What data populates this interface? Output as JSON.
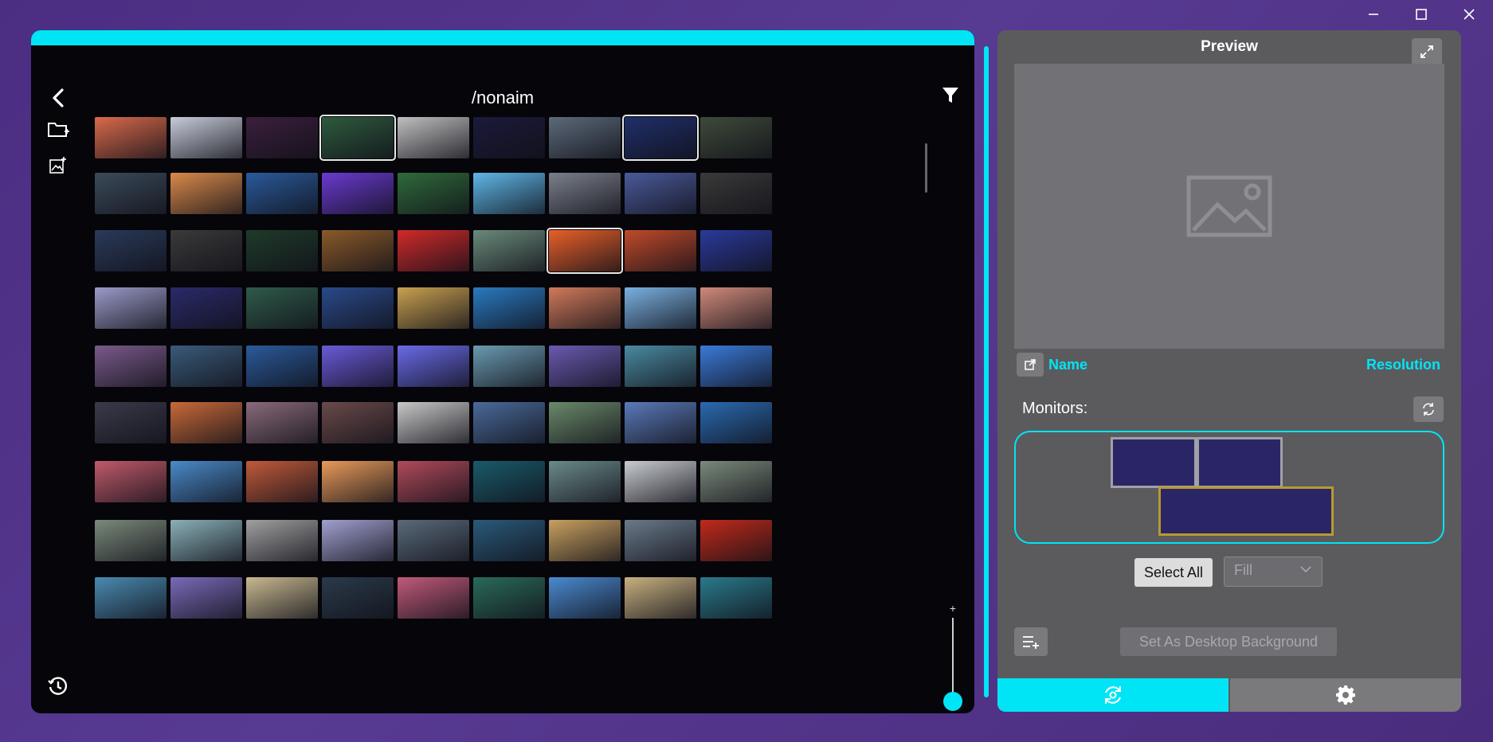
{
  "window_controls": {
    "minimize": "minimize-icon",
    "maximize": "maximize-icon",
    "close": "close-icon"
  },
  "browser": {
    "path": "/nonaim",
    "icons": {
      "back": "chevron-left-icon",
      "filter": "filter-icon",
      "new_folder": "folder-add-icon",
      "add_image": "image-add-icon",
      "history": "history-icon"
    },
    "zoom": {
      "plus": "+",
      "minus": "-",
      "level": 0.2
    },
    "thumbnails": [
      [
        "#d96a4c",
        "#c7ccd9",
        "#3a1f3c",
        "#2e5a3e",
        "#bfbfbf",
        "#1b1a3a",
        "#5c6a7a",
        "#1f2f6a",
        "#3e4a3a"
      ],
      [
        "#3b4a5a",
        "#d98a4a",
        "#2a5a9a",
        "#6a3ad0",
        "#2f6a3a",
        "#5fb7e8",
        "#7a7f8a",
        "#4a5a9a",
        "#3a3a3a"
      ],
      [
        "#2a3a5a",
        "#3a3a3a",
        "#1f3a2a",
        "#8a5a2a",
        "#d02a2a",
        "#6a8a7a",
        "#e8602a",
        "#c04a2a",
        "#2a3a9a"
      ],
      [
        "#9a9ac8",
        "#2a2a6a",
        "#2f5a4a",
        "#2a4a8a",
        "#c8a050",
        "#2a7ac0",
        "#d07a5a",
        "#7ab0e0",
        "#d08a7a"
      ],
      [
        "#7a5a8a",
        "#3a5a7a",
        "#2a5a9a",
        "#6a5ad8",
        "#6a6ae8",
        "#6a9ab0",
        "#6a5ab0",
        "#4a8aa0",
        "#3a7ad8"
      ],
      [
        "#3a3a4a",
        "#c86a3a",
        "#8a6a7a",
        "#6a4a4a",
        "#c8c8c8",
        "#4a6a9a",
        "#6a8a6a",
        "#5a7ab8",
        "#2a6ab0"
      ],
      [
        "#c05a6a",
        "#4a8ac8",
        "#c05a3a",
        "#e89a5a",
        "#b04a5a",
        "#1a5a6a",
        "#6a8a8a",
        "#c8ccd0",
        "#7a8a7a"
      ],
      [
        "#7a8a7a",
        "#8ab0b8",
        "#a0a0a0",
        "#a0a0d0",
        "#5a6a7a",
        "#2a5a7a",
        "#c8a060",
        "#6a7a8a",
        "#c02a1a"
      ],
      [
        "#4a8ab0",
        "#7a6ab8",
        "#c8b890",
        "#2a3a4a",
        "#c05a7a",
        "#2a6a5a",
        "#4a8ad0",
        "#c8b080",
        "#2a7a8a"
      ]
    ]
  },
  "preview": {
    "title": "Preview",
    "name_label": "Name",
    "resolution_label": "Resolution",
    "monitors_label": "Monitors:",
    "select_all_label": "Select All",
    "fill_mode": "Fill",
    "set_bg_label": "Set As Desktop Background",
    "icons": {
      "expand": "expand-icon",
      "open": "external-link-icon",
      "refresh": "refresh-icon",
      "queue": "queue-add-icon",
      "placeholder": "image-placeholder-icon"
    }
  },
  "tabs": {
    "left_icon": "wallpaper-sync-icon",
    "right_icon": "settings-gear-icon"
  }
}
